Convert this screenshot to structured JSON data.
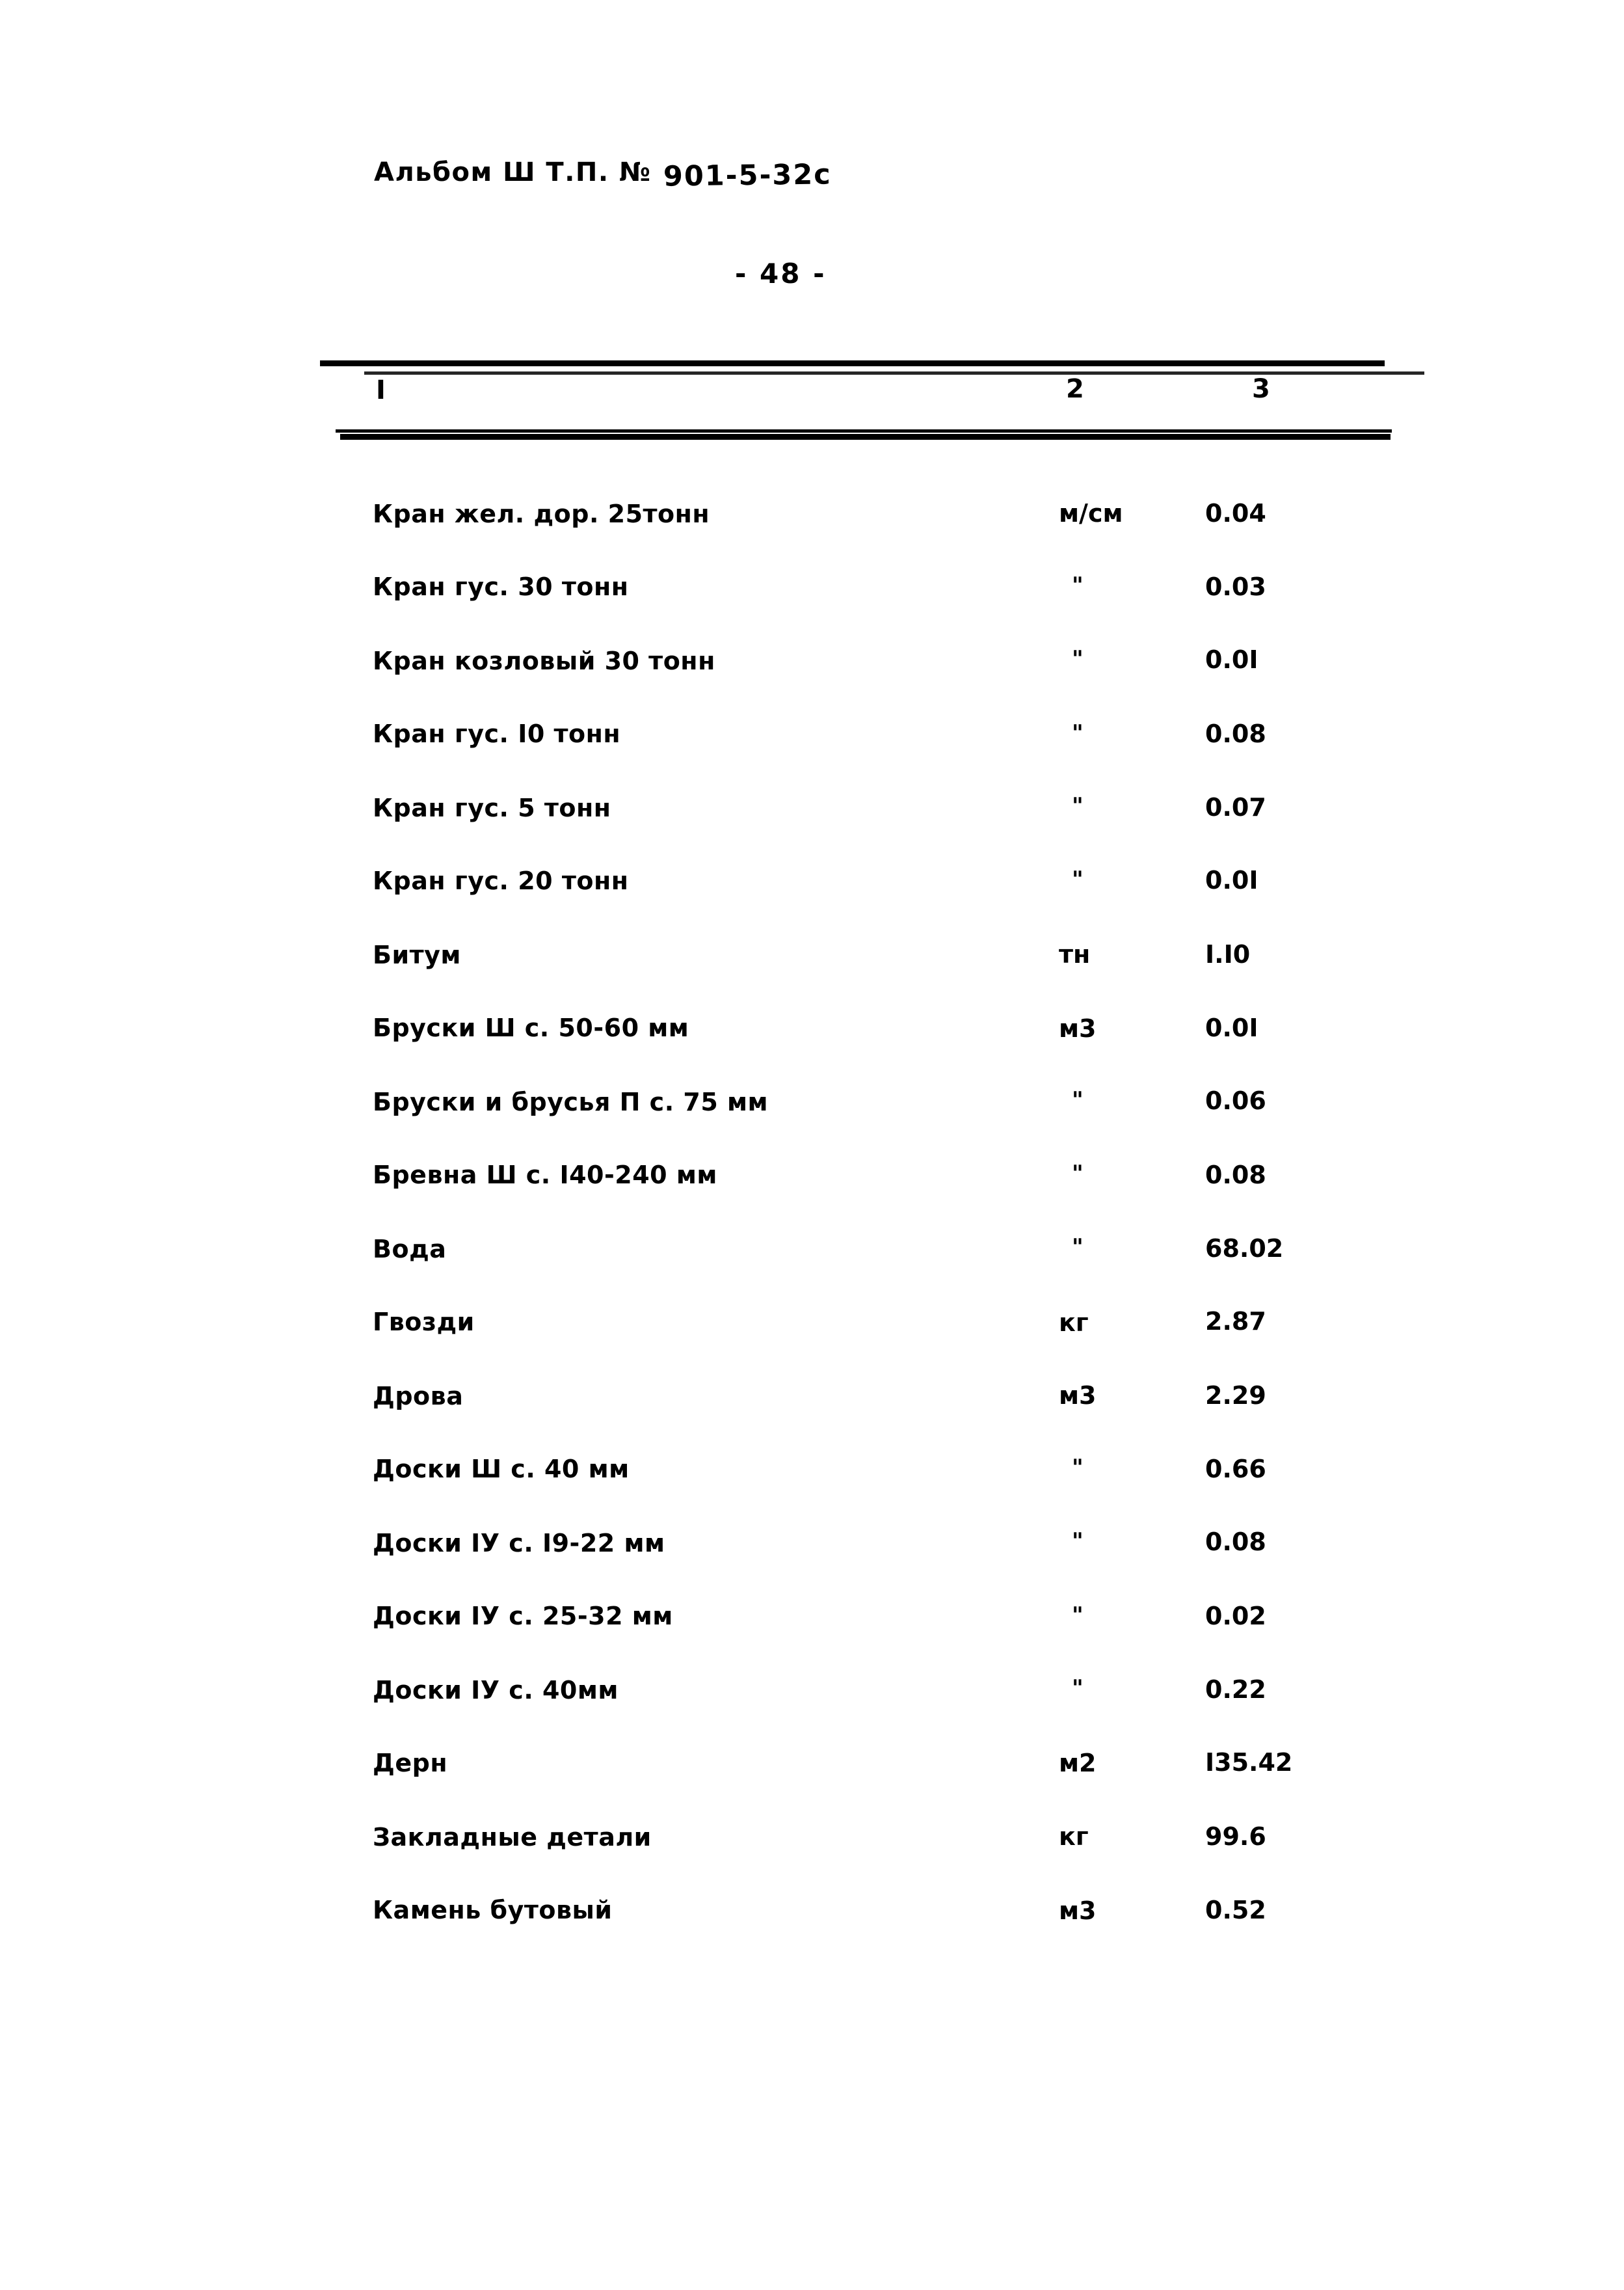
{
  "header": {
    "album_label": "Альбом Ш Т.П. №",
    "album_code": "901-5-32с"
  },
  "page_number": "- 48 -",
  "table": {
    "columns": [
      "I",
      "2",
      "3"
    ],
    "rows": [
      {
        "name": "Кран жел. дор. 25тонн",
        "unit": "м/см",
        "value": "0.04"
      },
      {
        "name": "Кран гус. 30 тонн",
        "unit": "\"",
        "value": "0.03"
      },
      {
        "name": "Кран козловый 30 тонн",
        "unit": "\"",
        "value": "0.0I"
      },
      {
        "name": "Кран гус. I0 тонн",
        "unit": "\"",
        "value": "0.08"
      },
      {
        "name": "Кран гус. 5 тонн",
        "unit": "\"",
        "value": "0.07"
      },
      {
        "name": "Кран гус. 20 тонн",
        "unit": "\"",
        "value": "0.0I"
      },
      {
        "name": "Битум",
        "unit": "тн",
        "value": "I.I0"
      },
      {
        "name": "Бруски Ш с. 50-60 мм",
        "unit": "м3",
        "value": "0.0I"
      },
      {
        "name": "Бруски и брусья П с. 75 мм",
        "unit": "\"",
        "value": "0.06"
      },
      {
        "name": "Бревна Ш с. I40-240 мм",
        "unit": "\"",
        "value": "0.08"
      },
      {
        "name": "Вода",
        "unit": "\"",
        "value": "68.02"
      },
      {
        "name": "Гвозди",
        "unit": "кг",
        "value": "2.87"
      },
      {
        "name": "Дрова",
        "unit": "м3",
        "value": "2.29"
      },
      {
        "name": "Доски Ш с. 40 мм",
        "unit": "\"",
        "value": "0.66"
      },
      {
        "name": "Доски IУ с. I9-22 мм",
        "unit": "\"",
        "value": "0.08"
      },
      {
        "name": "Доски IУ с. 25-32 мм",
        "unit": "\"",
        "value": "0.02"
      },
      {
        "name": "Доски IУ с. 40мм",
        "unit": "\"",
        "value": "0.22"
      },
      {
        "name": "Дерн",
        "unit": "м2",
        "value": "I35.42"
      },
      {
        "name": "Закладные детали",
        "unit": "кг",
        "value": "99.6"
      },
      {
        "name": "Камень бутовый",
        "unit": "м3",
        "value": "0.52"
      }
    ]
  }
}
